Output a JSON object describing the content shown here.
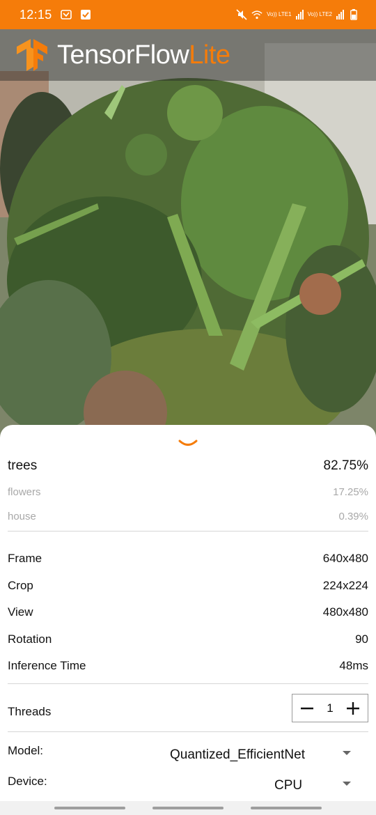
{
  "status_bar": {
    "time": "12:15",
    "icons": [
      "missed-call-icon",
      "checkbox-icon",
      "mute-icon",
      "wifi-icon",
      "signal-icon",
      "battery-icon"
    ],
    "sim1_label": "Vo)) LTE1",
    "sim2_label": "Vo)) LTE2",
    "background": "#f57c0a"
  },
  "header": {
    "logo_icon": "tensorflow-logo-icon",
    "brand_main": "TensorFlow",
    "brand_accent": "Lite",
    "accent_color": "#f57c0a"
  },
  "results": [
    {
      "label": "trees",
      "score": "82.75%"
    },
    {
      "label": "flowers",
      "score": "17.25%"
    },
    {
      "label": "house",
      "score": "0.39%"
    }
  ],
  "info": [
    {
      "label": "Frame",
      "value": "640x480"
    },
    {
      "label": "Crop",
      "value": "224x224"
    },
    {
      "label": "View",
      "value": "480x480"
    },
    {
      "label": "Rotation",
      "value": "90"
    },
    {
      "label": "Inference Time",
      "value": "48ms"
    }
  ],
  "threads": {
    "label": "Threads",
    "value": "1",
    "minus_icon": "minus-icon",
    "plus_icon": "plus-icon"
  },
  "model": {
    "label": "Model:",
    "selected": "Quantized_EfficientNet"
  },
  "device": {
    "label": "Device:",
    "selected": "CPU"
  }
}
